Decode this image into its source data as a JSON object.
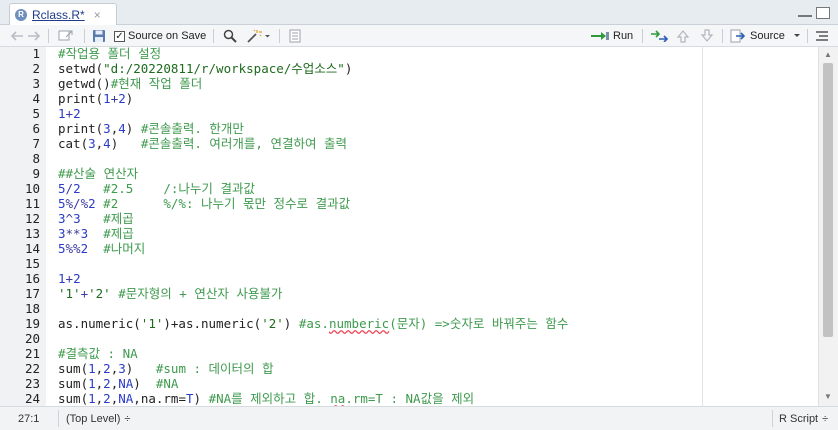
{
  "tab": {
    "file_icon": "R",
    "label": "Rclass.R*",
    "close": "×"
  },
  "toolbar": {
    "source_on_save_label": "Source on Save",
    "run_label": "Run",
    "source_label": "Source"
  },
  "editor": {
    "lines": [
      {
        "num": "1",
        "tokens": [
          {
            "t": "#작업용 폴더 설정",
            "c": "c"
          }
        ]
      },
      {
        "num": "2",
        "tokens": [
          {
            "t": "setwd(",
            "c": "p"
          },
          {
            "t": "\"d:/20220811/r/workspace/수업소스\"",
            "c": "s"
          },
          {
            "t": ")",
            "c": "p"
          }
        ]
      },
      {
        "num": "3",
        "tokens": [
          {
            "t": "getwd()",
            "c": "p"
          },
          {
            "t": "#현재 작업 폴더",
            "c": "c"
          }
        ]
      },
      {
        "num": "4",
        "tokens": [
          {
            "t": "print(",
            "c": "p"
          },
          {
            "t": "1",
            "c": "n"
          },
          {
            "t": "+",
            "c": "o"
          },
          {
            "t": "2",
            "c": "n"
          },
          {
            "t": ")",
            "c": "p"
          }
        ]
      },
      {
        "num": "5",
        "tokens": [
          {
            "t": "1",
            "c": "n"
          },
          {
            "t": "+",
            "c": "o"
          },
          {
            "t": "2",
            "c": "n"
          }
        ]
      },
      {
        "num": "6",
        "tokens": [
          {
            "t": "print(",
            "c": "p"
          },
          {
            "t": "3",
            "c": "n"
          },
          {
            "t": ",",
            "c": "p"
          },
          {
            "t": "4",
            "c": "n"
          },
          {
            "t": ") ",
            "c": "p"
          },
          {
            "t": "#콘솔출력. 한개만",
            "c": "c"
          }
        ]
      },
      {
        "num": "7",
        "tokens": [
          {
            "t": "cat(",
            "c": "p"
          },
          {
            "t": "3",
            "c": "n"
          },
          {
            "t": ",",
            "c": "p"
          },
          {
            "t": "4",
            "c": "n"
          },
          {
            "t": ")   ",
            "c": "p"
          },
          {
            "t": "#콘솔출력. 여러개를, 연결하여 출력",
            "c": "c"
          }
        ]
      },
      {
        "num": "8",
        "tokens": []
      },
      {
        "num": "9",
        "tokens": [
          {
            "t": "##산술 연산자",
            "c": "c"
          }
        ]
      },
      {
        "num": "10",
        "tokens": [
          {
            "t": "5",
            "c": "n"
          },
          {
            "t": "/",
            "c": "o"
          },
          {
            "t": "2",
            "c": "n"
          },
          {
            "t": "   ",
            "c": "p"
          },
          {
            "t": "#2.5    /:나누기 결과값",
            "c": "c"
          }
        ]
      },
      {
        "num": "11",
        "tokens": [
          {
            "t": "5",
            "c": "n"
          },
          {
            "t": "%/%",
            "c": "o"
          },
          {
            "t": "2",
            "c": "n"
          },
          {
            "t": " ",
            "c": "p"
          },
          {
            "t": "#2      %/%: 나누기 몫만 정수로 결과값",
            "c": "c"
          }
        ]
      },
      {
        "num": "12",
        "tokens": [
          {
            "t": "3",
            "c": "n"
          },
          {
            "t": "^",
            "c": "o"
          },
          {
            "t": "3",
            "c": "n"
          },
          {
            "t": "   ",
            "c": "p"
          },
          {
            "t": "#제곱",
            "c": "c"
          }
        ]
      },
      {
        "num": "13",
        "tokens": [
          {
            "t": "3",
            "c": "n"
          },
          {
            "t": "**",
            "c": "o"
          },
          {
            "t": "3",
            "c": "n"
          },
          {
            "t": "  ",
            "c": "p"
          },
          {
            "t": "#제곱",
            "c": "c"
          }
        ]
      },
      {
        "num": "14",
        "tokens": [
          {
            "t": "5",
            "c": "n"
          },
          {
            "t": "%%",
            "c": "o"
          },
          {
            "t": "2",
            "c": "n"
          },
          {
            "t": "  ",
            "c": "p"
          },
          {
            "t": "#나머지",
            "c": "c"
          }
        ]
      },
      {
        "num": "15",
        "tokens": []
      },
      {
        "num": "16",
        "tokens": [
          {
            "t": "1",
            "c": "n"
          },
          {
            "t": "+",
            "c": "o"
          },
          {
            "t": "2",
            "c": "n"
          }
        ]
      },
      {
        "num": "17",
        "tokens": [
          {
            "t": "'1'",
            "c": "s"
          },
          {
            "t": "+",
            "c": "o"
          },
          {
            "t": "'2'",
            "c": "s"
          },
          {
            "t": " ",
            "c": "p"
          },
          {
            "t": "#문자형의 + 연산자 사용불가",
            "c": "c"
          }
        ]
      },
      {
        "num": "18",
        "tokens": []
      },
      {
        "num": "19",
        "tokens": [
          {
            "t": "as.numeric(",
            "c": "p"
          },
          {
            "t": "'1'",
            "c": "s"
          },
          {
            "t": ")+as.numeric(",
            "c": "p"
          },
          {
            "t": "'2'",
            "c": "s"
          },
          {
            "t": ") ",
            "c": "p"
          },
          {
            "t": "#as.",
            "c": "c"
          },
          {
            "t": "numberic",
            "c": "c",
            "sq": true
          },
          {
            "t": "(문자) =>숫자로 바꿔주는 함수",
            "c": "c"
          }
        ]
      },
      {
        "num": "20",
        "tokens": []
      },
      {
        "num": "21",
        "tokens": [
          {
            "t": "#결측값 : NA",
            "c": "c"
          }
        ]
      },
      {
        "num": "22",
        "tokens": [
          {
            "t": "sum(",
            "c": "p"
          },
          {
            "t": "1",
            "c": "n"
          },
          {
            "t": ",",
            "c": "p"
          },
          {
            "t": "2",
            "c": "n"
          },
          {
            "t": ",",
            "c": "p"
          },
          {
            "t": "3",
            "c": "n"
          },
          {
            "t": ")   ",
            "c": "p"
          },
          {
            "t": "#sum : 데이터의 합",
            "c": "c"
          }
        ]
      },
      {
        "num": "23",
        "tokens": [
          {
            "t": "sum(",
            "c": "p"
          },
          {
            "t": "1",
            "c": "n"
          },
          {
            "t": ",",
            "c": "p"
          },
          {
            "t": "2",
            "c": "n"
          },
          {
            "t": ",",
            "c": "p"
          },
          {
            "t": "NA",
            "c": "n"
          },
          {
            "t": ")  ",
            "c": "p"
          },
          {
            "t": "#NA",
            "c": "c"
          }
        ]
      },
      {
        "num": "24",
        "tokens": [
          {
            "t": "sum(",
            "c": "p"
          },
          {
            "t": "1",
            "c": "n"
          },
          {
            "t": ",",
            "c": "p"
          },
          {
            "t": "2",
            "c": "n"
          },
          {
            "t": ",",
            "c": "p"
          },
          {
            "t": "NA",
            "c": "n"
          },
          {
            "t": ",na.rm=",
            "c": "p"
          },
          {
            "t": "T",
            "c": "n"
          },
          {
            "t": ") ",
            "c": "p"
          },
          {
            "t": "#NA를 제외하고 합. ",
            "c": "c"
          },
          {
            "t": "na",
            "c": "c",
            "sq": true
          },
          {
            "t": ".rm=T : NA값을 제외",
            "c": "c"
          }
        ]
      }
    ]
  },
  "status": {
    "position": "27:1",
    "scope": "(Top Level)",
    "scope_arrow": "÷",
    "file_type": "R Script",
    "file_type_arrow": "÷"
  },
  "colors": {
    "comment": "#3f9a4e",
    "string": "#1e6b1e",
    "number": "#2b3bc9",
    "tab_text": "#1f3b8a",
    "run_arrow": "#2e9a3e"
  }
}
